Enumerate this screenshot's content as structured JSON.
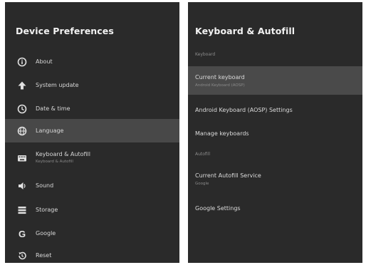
{
  "left_panel": {
    "title": "Device Preferences",
    "items": [
      {
        "label": "About",
        "icon": "info-icon"
      },
      {
        "label": "System update",
        "icon": "upload-arrow-icon"
      },
      {
        "label": "Date & time",
        "icon": "clock-icon"
      },
      {
        "label": "Language",
        "icon": "globe-icon"
      },
      {
        "label": "Keyboard & Autofill",
        "sub": "Keyboard & Autofill",
        "icon": "keyboard-icon"
      },
      {
        "label": "Sound",
        "icon": "speaker-icon"
      },
      {
        "label": "Storage",
        "icon": "storage-icon"
      },
      {
        "label": "Google",
        "icon": "google-icon"
      },
      {
        "label": "Reset",
        "icon": "reset-icon"
      }
    ]
  },
  "right_panel": {
    "title": "Keyboard & Autofill",
    "section_keyboard": "Keyboard",
    "current_keyboard": {
      "label": "Current keyboard",
      "sub": "Android Keyboard (AOSP)"
    },
    "aosp_settings": "Android Keyboard (AOSP) Settings",
    "manage_keyboards": "Manage keyboards",
    "section_autofill": "Autofill",
    "autofill_service": {
      "label": "Current Autofill Service",
      "sub": "Google"
    },
    "google_settings": "Google Settings"
  },
  "colors": {
    "panel_bg": "#2a2a2a",
    "highlight": "#484848",
    "text": "#dcdcdc"
  }
}
